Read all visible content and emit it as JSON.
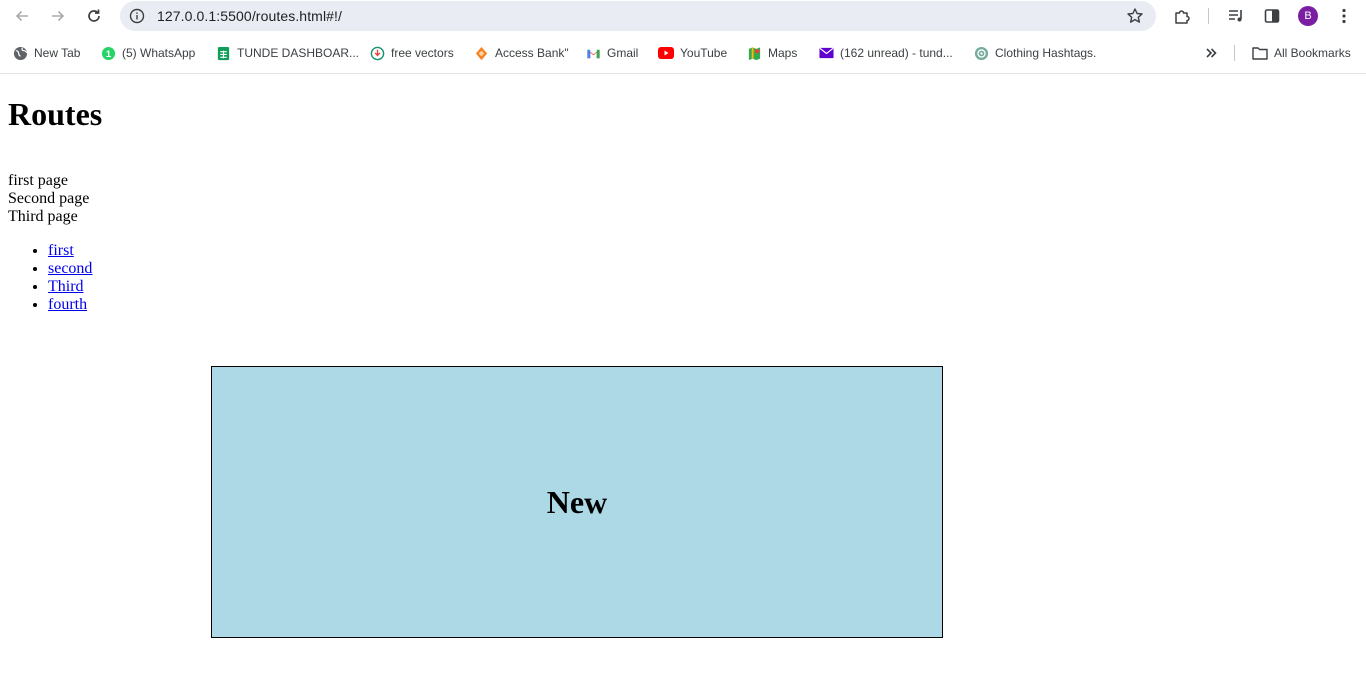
{
  "browser": {
    "url": "127.0.0.1:5500/routes.html#!/",
    "avatar_letter": "B",
    "colors": {
      "omnibox": "#e9edf3",
      "avatar": "#7b1fa2"
    }
  },
  "bookmarks": {
    "items": [
      {
        "label": "New Tab",
        "icon": "globe-icon"
      },
      {
        "label": "(5) WhatsApp",
        "icon": "whatsapp-icon"
      },
      {
        "label": "TUNDE DASHBOAR...",
        "icon": "sheets-icon"
      },
      {
        "label": "free vectors",
        "icon": "download-icon"
      },
      {
        "label": "Access Bank\"",
        "icon": "access-bank-icon"
      },
      {
        "label": "Gmail",
        "icon": "gmail-icon"
      },
      {
        "label": "YouTube",
        "icon": "youtube-icon"
      },
      {
        "label": "Maps",
        "icon": "maps-icon"
      },
      {
        "label": "(162 unread) - tund...",
        "icon": "mail-icon"
      },
      {
        "label": "Clothing Hashtags.",
        "icon": "chatgpt-icon"
      }
    ],
    "all_bookmarks_label": "All Bookmarks"
  },
  "page": {
    "title": "Routes",
    "lines": [
      "first page",
      "Second page",
      "Third page"
    ],
    "links": [
      "first",
      "second",
      "Third",
      "fourth"
    ],
    "view": {
      "heading": "New",
      "background": "#add8e6"
    }
  }
}
